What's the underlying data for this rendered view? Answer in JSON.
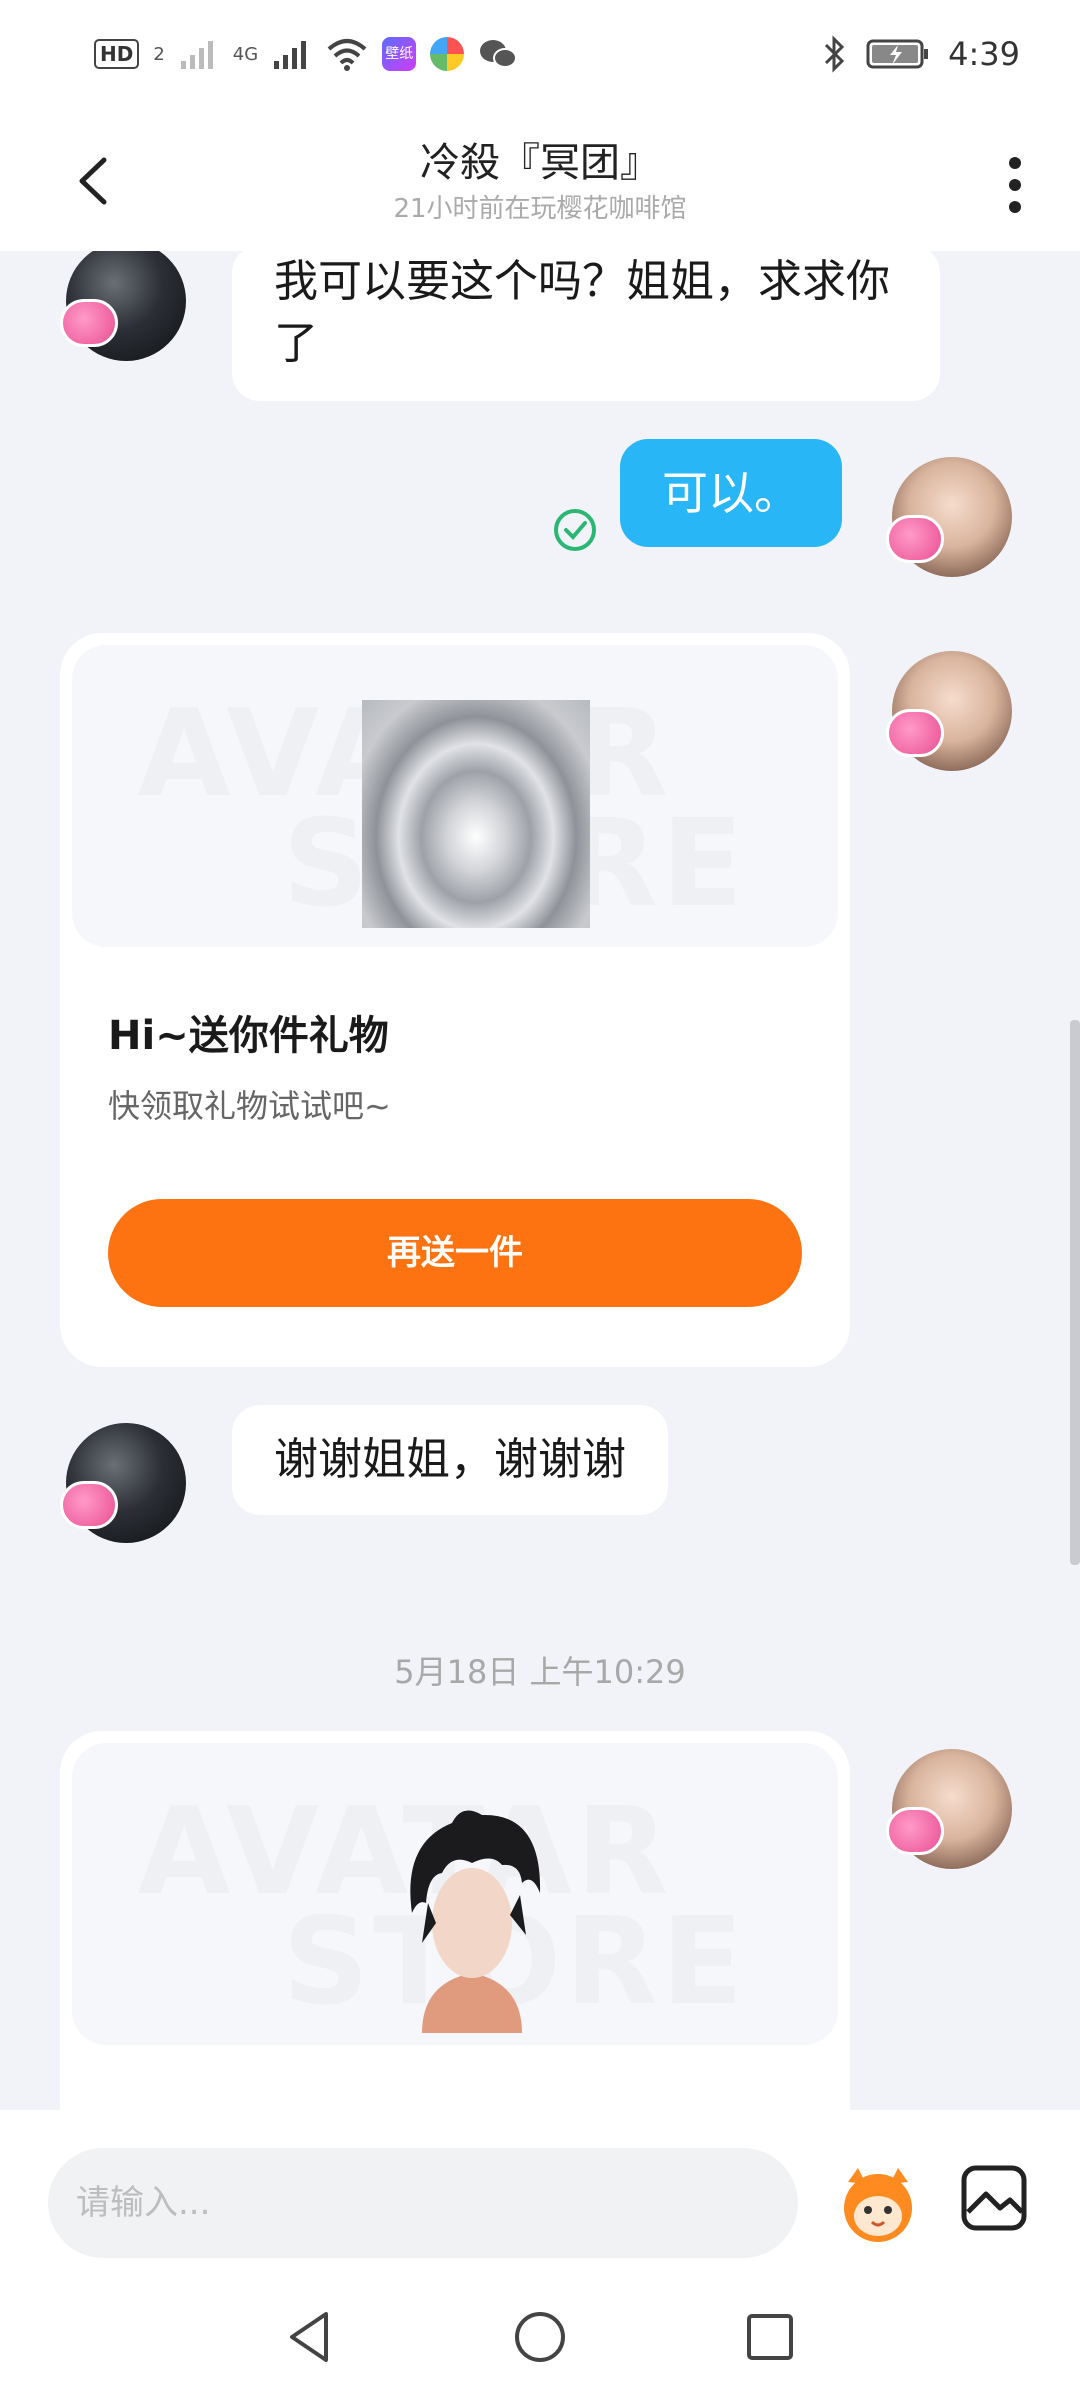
{
  "status_bar": {
    "hd_label": "HD",
    "sim_slot": "2",
    "net_label": "4G",
    "wallpaper_label": "壁纸",
    "time": "4:39"
  },
  "header": {
    "title": "冷殺『冥团』",
    "subtitle": "21小时前在玩樱花咖啡馆"
  },
  "messages": {
    "m1": {
      "text": "我可以要这个吗？姐姐，求求你了"
    },
    "m2": {
      "text": "可以。"
    },
    "gift_card": {
      "watermark_top": "AVATAR",
      "watermark_bottom": "STORE",
      "title": "Hi~送你件礼物",
      "subtitle": "快领取礼物试试吧~",
      "button": "再送一件"
    },
    "m3": {
      "text": "谢谢姐姐，谢谢谢"
    },
    "timestamp": "5月18日 上午10:29",
    "card2": {
      "watermark_top": "AVATAR",
      "watermark_bottom": "STORE"
    }
  },
  "input": {
    "placeholder": "请输入..."
  },
  "colors": {
    "accent_blue": "#29b6f6",
    "accent_orange": "#fe7311",
    "check_green": "#2bb673"
  }
}
